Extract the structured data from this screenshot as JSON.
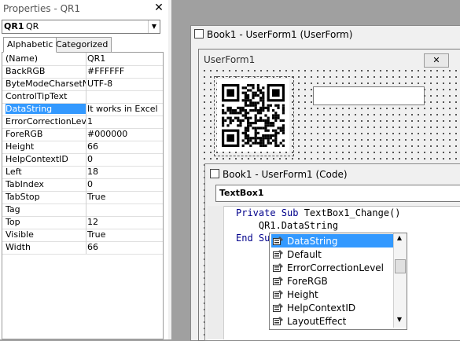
{
  "properties": {
    "title": "Properties - QR1",
    "object_name": "QR1",
    "object_type": "QR",
    "tabs": [
      "Alphabetic",
      "Categorized"
    ],
    "rows": [
      {
        "name": "(Name)",
        "value": "QR1"
      },
      {
        "name": "BackRGB",
        "value": "#FFFFFF"
      },
      {
        "name": "ByteModeCharsetNa",
        "value": "UTF-8"
      },
      {
        "name": "ControlTipText",
        "value": ""
      },
      {
        "name": "DataString",
        "value": "It works in Excel",
        "selected": true
      },
      {
        "name": "ErrorCorrectionLevel",
        "value": "1"
      },
      {
        "name": "ForeRGB",
        "value": "#000000"
      },
      {
        "name": "Height",
        "value": "66"
      },
      {
        "name": "HelpContextID",
        "value": "0"
      },
      {
        "name": "Left",
        "value": "18"
      },
      {
        "name": "TabIndex",
        "value": "0"
      },
      {
        "name": "TabStop",
        "value": "True"
      },
      {
        "name": "Tag",
        "value": ""
      },
      {
        "name": "Top",
        "value": "12"
      },
      {
        "name": "Visible",
        "value": "True"
      },
      {
        "name": "Width",
        "value": "66"
      }
    ]
  },
  "userform_window": {
    "title": "Book1 - UserForm1 (UserForm)",
    "form_title": "UserForm1",
    "close_glyph": "✕"
  },
  "code_window": {
    "title": "Book1 - UserForm1 (Code)",
    "object_combo": "TextBox1",
    "line1_kw": "Private Sub",
    "line1_rest": " TextBox1_Change()",
    "line2": "    QR1.DataString",
    "line3_kw": "End Su"
  },
  "intellisense": {
    "items": [
      "DataString",
      "Default",
      "ErrorCorrectionLevel",
      "ForeRGB",
      "Height",
      "HelpContextID",
      "LayoutEffect"
    ],
    "selected_index": 0
  },
  "colors": {
    "selection": "#3399ff",
    "keyword": "#00008b"
  }
}
